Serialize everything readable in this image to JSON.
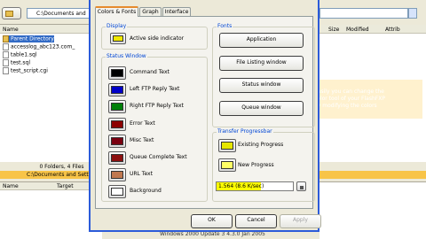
{
  "toolbar": {
    "path": "C:\\Documents and"
  },
  "filelist": {
    "header_name": "Name",
    "items": [
      {
        "name": "Parent Directory",
        "selected": true
      },
      {
        "name": "accesslog_abc123.com_",
        "selected": false
      },
      {
        "name": "table1.sql",
        "selected": false
      },
      {
        "name": "test.sql",
        "selected": false
      },
      {
        "name": "test_script.cgi",
        "selected": false
      }
    ],
    "status": "0 Folders, 4 Files",
    "pathbar": "C:\\Documents and Sett"
  },
  "remote": {
    "col_size": "Size",
    "col_modified": "Modified",
    "col_attrib": "Attrib"
  },
  "queue": {
    "col_name": "Name",
    "col_target": "Target"
  },
  "bottom_text": "Windows 2000 Update 3 4.3.0 Jan 2005",
  "tooltip": {
    "lines": [
      "Easily you can change the",
      "color tool of your FlashFXP",
      "by modifying the colors"
    ]
  },
  "dialog": {
    "tabs": [
      "Colors & Fonts",
      "Graph",
      "Interface"
    ],
    "display": {
      "title": "Display",
      "item": "Active side indicator",
      "color": "#f0e800"
    },
    "status_window": {
      "title": "Status Window",
      "items": [
        {
          "label": "Command Text",
          "color": "#000000"
        },
        {
          "label": "Left FTP Reply Text",
          "color": "#0000c8"
        },
        {
          "label": "Right FTP Reply Text",
          "color": "#00800a"
        },
        {
          "label": "Error Text",
          "color": "#8c0000"
        },
        {
          "label": "Misc Text",
          "color": "#7a0010"
        },
        {
          "label": "Queue Complete Text",
          "color": "#8c1010"
        },
        {
          "label": "URL Text",
          "color": "#c07850"
        },
        {
          "label": "Background",
          "color": "#ffffff"
        }
      ]
    },
    "fonts": {
      "title": "Fonts",
      "buttons": [
        "Application",
        "File Listing window",
        "Status window",
        "Queue window"
      ]
    },
    "transfer": {
      "title": "Transfer Progressbar",
      "items": [
        {
          "label": "Existing Progress",
          "color": "#e6e600"
        },
        {
          "label": "New Progress",
          "color": "#ffff66"
        }
      ],
      "progress_text": "1.564 (8.6 K/sec)",
      "progress_level": 0.58
    },
    "footer": {
      "ok": "OK",
      "cancel": "Cancel",
      "apply": "Apply"
    }
  }
}
